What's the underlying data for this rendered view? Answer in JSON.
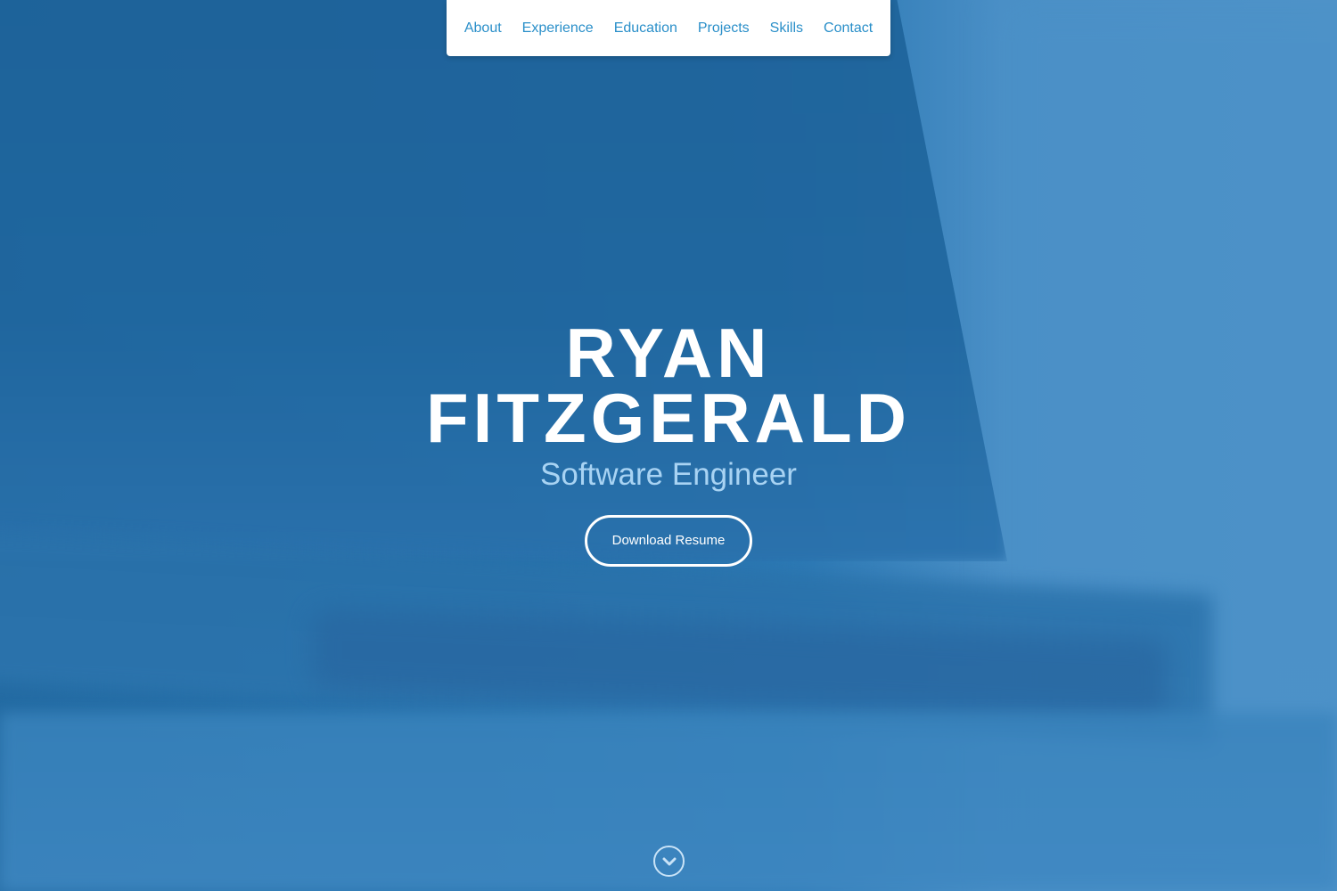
{
  "nav": {
    "items": [
      {
        "label": "About"
      },
      {
        "label": "Experience"
      },
      {
        "label": "Education"
      },
      {
        "label": "Projects"
      },
      {
        "label": "Skills"
      },
      {
        "label": "Contact"
      }
    ]
  },
  "hero": {
    "name_line1": "RYAN",
    "name_line2": "FITZGERALD",
    "subtitle": "Software Engineer",
    "button_label": "Download Resume",
    "scroll_icon": "chevron-down-circle-icon"
  },
  "colors": {
    "nav_link": "#2a8fc9",
    "subtitle": "#a8d3f3",
    "background": "#2e78b0"
  }
}
